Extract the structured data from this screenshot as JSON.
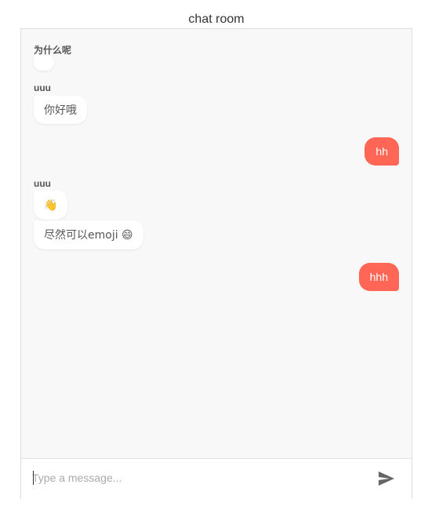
{
  "header": {
    "title": "chat room"
  },
  "messages": [
    {
      "sender": "为什么呢",
      "direction": "incoming",
      "text": ""
    },
    {
      "sender": "uuu",
      "direction": "incoming",
      "text": "你好哦"
    },
    {
      "sender": "",
      "direction": "outgoing",
      "text": "hh"
    },
    {
      "sender": "uuu",
      "direction": "incoming",
      "text": "👋"
    },
    {
      "sender": "",
      "direction": "incoming",
      "text": "尽然可以emoji 😄"
    },
    {
      "sender": "",
      "direction": "outgoing",
      "text": "hhh"
    }
  ],
  "composer": {
    "placeholder": "Type a message...",
    "value": "",
    "send_icon": "send-icon"
  },
  "colors": {
    "outgoing_bubble": "#ff6655",
    "incoming_bubble": "#ffffff",
    "chat_background": "#f8f8f8"
  }
}
